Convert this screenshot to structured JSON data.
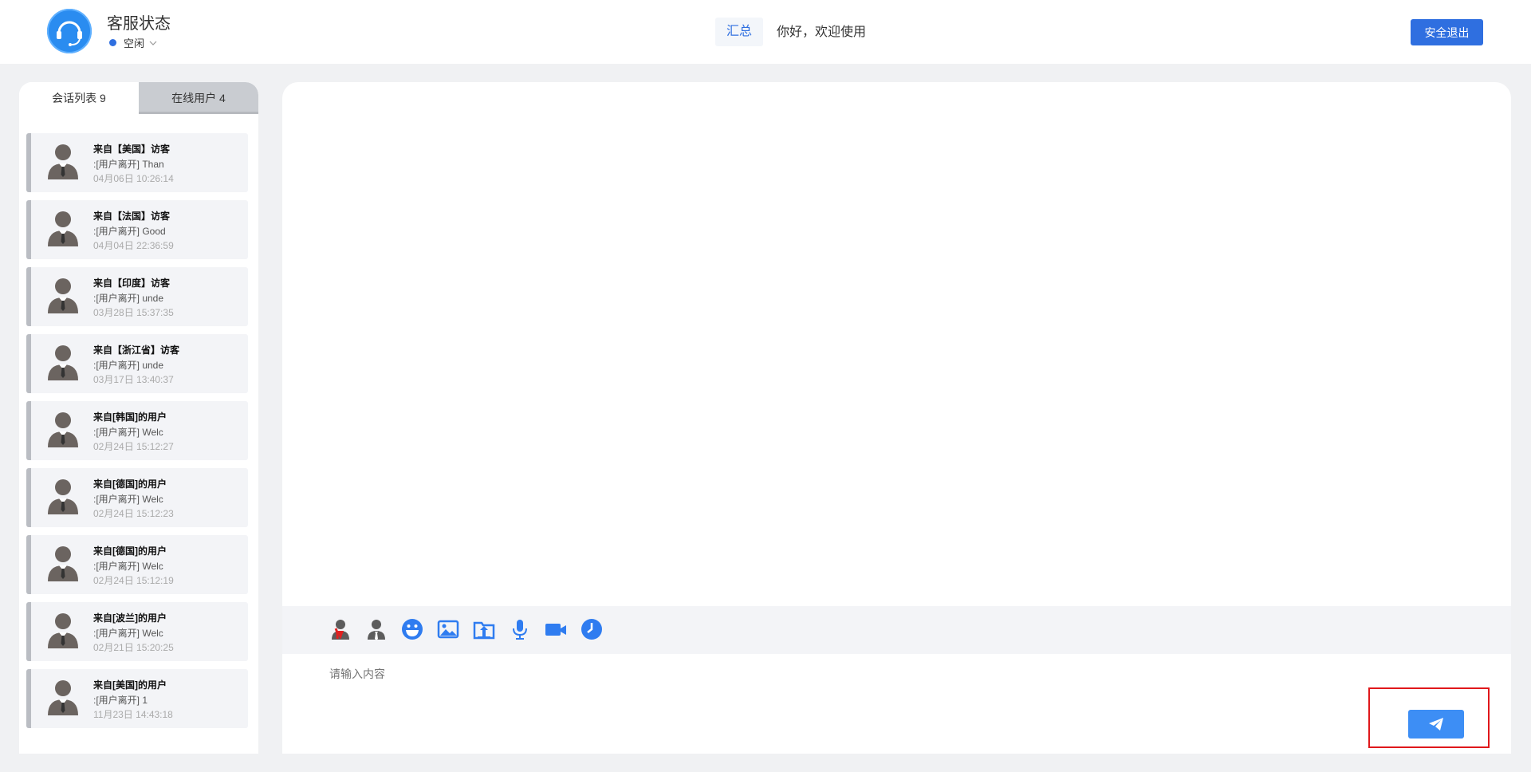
{
  "header": {
    "title": "客服状态",
    "status": "空闲",
    "user_name": "汇总",
    "welcome": "你好，欢迎使用",
    "logout_label": "安全退出"
  },
  "tabs": {
    "conversations": "会话列表 9",
    "online_users": "在线用户 4"
  },
  "conversations": [
    {
      "title": "来自【美国】访客",
      "message": ":[用户离开] Than",
      "time": "04月06日 10:26:14"
    },
    {
      "title": "来自【法国】访客",
      "message": ":[用户离开] Good",
      "time": "04月04日 22:36:59"
    },
    {
      "title": "来自【印度】访客",
      "message": ":[用户离开] unde",
      "time": "03月28日 15:37:35"
    },
    {
      "title": "来自【浙江省】访客",
      "message": ":[用户离开] unde",
      "time": "03月17日 13:40:37"
    },
    {
      "title": "来自[韩国]的用户",
      "message": ":[用户离开] Welc",
      "time": "02月24日 15:12:27"
    },
    {
      "title": "来自[德国]的用户",
      "message": ":[用户离开] Welc",
      "time": "02月24日 15:12:23"
    },
    {
      "title": "来自[德国]的用户",
      "message": ":[用户离开] Welc",
      "time": "02月24日 15:12:19"
    },
    {
      "title": "来自[波兰]的用户",
      "message": ":[用户离开] Welc",
      "time": "02月21日 15:20:25"
    },
    {
      "title": "来自[美国]的用户",
      "message": ":[用户离开] 1",
      "time": "11月23日 14:43:18"
    }
  ],
  "toolbar_icons": [
    "transfer-user-icon",
    "user-info-icon",
    "emoji-icon",
    "image-icon",
    "file-upload-icon",
    "microphone-icon",
    "video-icon",
    "history-clock-icon"
  ],
  "input": {
    "placeholder": "请输入内容"
  },
  "colors": {
    "primary": "#2f6fe0",
    "send_button": "#3d8ef5",
    "highlight": "#e0181b"
  }
}
